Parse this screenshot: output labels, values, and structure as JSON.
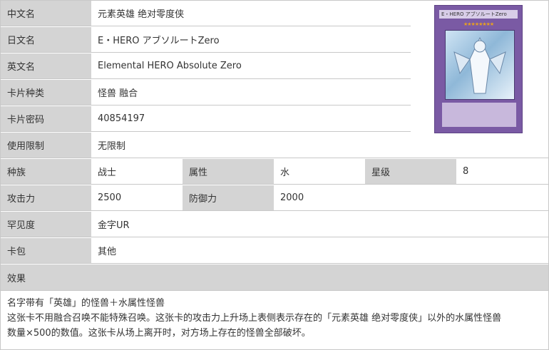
{
  "rows": [
    {
      "label": "中文名",
      "value": "元素英雄 绝对零度侠"
    },
    {
      "label": "日文名",
      "value": "E・HERO アブソルートZero"
    },
    {
      "label": "英文名",
      "value": "Elemental HERO Absolute Zero"
    },
    {
      "label": "卡片种类",
      "value": "怪兽 融合"
    },
    {
      "label": "卡片密码",
      "value": "40854197"
    },
    {
      "label": "使用限制",
      "value": "无限制"
    }
  ],
  "stats_row1": {
    "race_label": "种族",
    "race_value": "战士",
    "attr_label": "属性",
    "attr_value": "水",
    "level_label": "星级",
    "level_value": "8"
  },
  "stats_row2": {
    "atk_label": "攻击力",
    "atk_value": "2500",
    "def_label": "防御力",
    "def_value": "2000"
  },
  "rarity": {
    "label": "罕见度",
    "value": "金字UR"
  },
  "pack": {
    "label": "卡包",
    "value": "其他"
  },
  "effect": {
    "label": "效果",
    "lines": [
      "名字带有「英雄」的怪兽＋水属性怪兽",
      "这张卡不用融合召唤不能特殊召唤。这张卡的攻击力上升场上表侧表示存在的「元素英雄 绝对零度侠」以外的水属性怪兽",
      "数量×500的数值。这张卡从场上离开时，对方场上存在的怪兽全部破坏。"
    ]
  },
  "card_image": {
    "name_text": "E・HERO アブソルートZero",
    "stars": "★★★★★★★★",
    "frame_color": "#7a5aa4"
  }
}
